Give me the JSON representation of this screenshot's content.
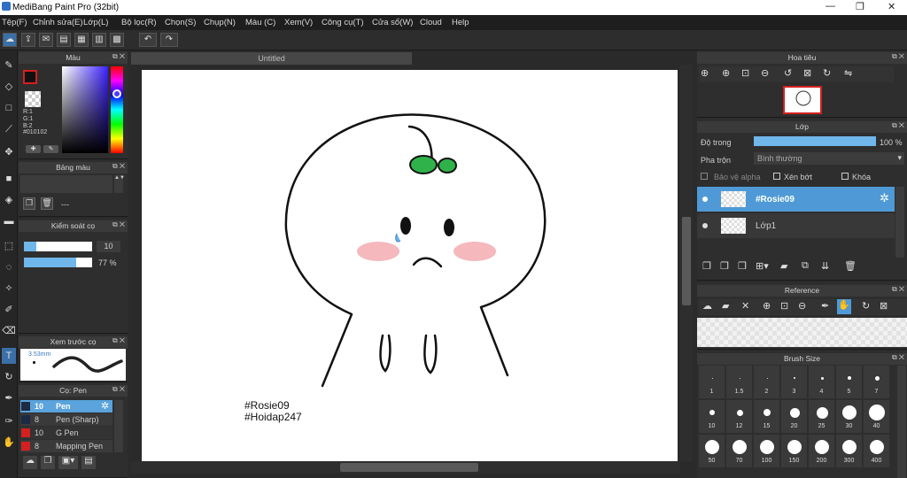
{
  "window": {
    "title": "MediBang Paint Pro (32bit)",
    "minimize": "—",
    "maximize": "❐",
    "close": "✕"
  },
  "menu": [
    "Tệp(F)",
    "Chỉnh sửa(E)",
    "Lớp(L)",
    "Bộ lọc(R)",
    "Chọn(S)",
    "Chụp(N)",
    "Màu (C)",
    "Xem(V)",
    "Công cụ(T)",
    "Cửa sổ(W)",
    "Cloud",
    "Help"
  ],
  "document": {
    "tab": "Untitled"
  },
  "canvas": {
    "caption_line1": "#Rosie09",
    "caption_line2": "#Hoidap247"
  },
  "color_panel": {
    "title": "Màu",
    "r": "R:1",
    "g": "G:1",
    "b": "B:2",
    "hex": "#010102",
    "primary": "#d42020",
    "hue_cursor": "#ffffff"
  },
  "palette_panel": {
    "title": "Bảng màu",
    "name": "---"
  },
  "brush_control": {
    "title": "Kiểm soát cọ",
    "size": "10",
    "opacity": "77 %",
    "opacity_value": 0.77
  },
  "preview_panel": {
    "title": "Xem trước cọ",
    "size": "3.53mm"
  },
  "brush_list": {
    "title": "Cọ: Pen",
    "items": [
      {
        "size": "10",
        "name": "Pen",
        "color": "#1c2a44",
        "selected": true
      },
      {
        "size": "8",
        "name": "Pen (Sharp)",
        "color": "#1c2a44",
        "selected": false
      },
      {
        "size": "10",
        "name": "G Pen",
        "color": "#d42020",
        "selected": false
      },
      {
        "size": "8",
        "name": "Mapping Pen",
        "color": "#d42020",
        "selected": false
      }
    ]
  },
  "navigator": {
    "title": "Hoa tiêu"
  },
  "layer_panel": {
    "title": "Lớp",
    "opacity_label": "Độ trong",
    "opacity_value": "100 %",
    "blend_label": "Pha trộn",
    "blend_value": "Bình thường",
    "protect_alpha": "Bảo vệ alpha",
    "clipping": "Xén bớt",
    "lock": "Khóa",
    "layers": [
      {
        "name": "#Rosie09",
        "selected": true
      },
      {
        "name": "Lớp1",
        "selected": false
      }
    ]
  },
  "reference_panel": {
    "title": "Reference"
  },
  "brush_size_panel": {
    "title": "Brush Size",
    "sizes": [
      "1",
      "1.5",
      "2",
      "3",
      "4",
      "5",
      "7",
      "10",
      "12",
      "15",
      "20",
      "25",
      "30",
      "40",
      "50",
      "70",
      "100",
      "150",
      "200",
      "300",
      "400"
    ]
  }
}
